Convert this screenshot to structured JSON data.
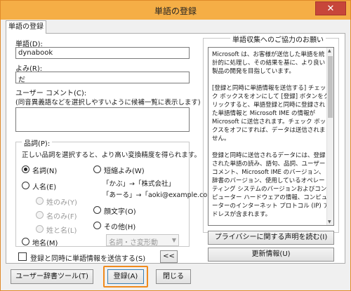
{
  "window": {
    "title": "単語の登録",
    "close_glyph": "✕"
  },
  "tab": {
    "label": "単語の登録"
  },
  "word": {
    "label": "単語(D):",
    "value": "dynabook"
  },
  "reading": {
    "label": "よみ(R):",
    "value": "だ"
  },
  "comment": {
    "label": "ユーザー コメント(C):",
    "hint": "(同音異義語などを選択しやすいように候補一覧に表示します)",
    "value": ""
  },
  "pos_group": {
    "title": "品詞(P):",
    "description": "正しい品詞を選択すると、より高い変換精度を得られます。",
    "options": {
      "noun": "名詞(N)",
      "abbrev": "短縮よみ(W)",
      "abbrev_example1": "「かぶ」→「株式会社」",
      "abbrev_example2": "「あーる」→「aoki@example.com」",
      "person": "人名(E)",
      "surname": "姓のみ(Y)",
      "given": "名のみ(F)",
      "fullname": "姓と名(L)",
      "emoticon": "顔文字(O)",
      "other": "その他(H)",
      "place": "地名(M)",
      "other_select": "名詞・さ変形動"
    }
  },
  "send_checkbox": {
    "label": "登録と同時に単語情報を送信する(S)",
    "checked": false
  },
  "collapse_button": "<<",
  "info_panel": {
    "title": "単語収集へのご協力のお願い",
    "text": "Microsoft は、お客様が送信した単語を統計的に処理し、その結果を基に、より良い製品の開発を目指しています。\n\n[登録と同時に単語情報を送信する] チェック ボックスをオンにして [登録] ボタンをクリックすると、単語登録と同時に登録された単語情報と Microsoft IME の情報が Microsoft に送信されます。チェック ボックスをオフにすれば、データは送信されません。\n\n登録と同時に送信されるデータには、登録された単語の読み、語句、品詞、ユーザー コメント、Microsoft IME のバージョン、辞書のバージョン、使用しているオペレーティング システムのバージョンおよびコンピューター ハードウェアの情報、コンピューターのインターネット プロトコル (IP) アドレスが含まれます。\n\nお客様特有の情報が収集されたデータに含まれることがあります。このような情報が存在する場合でも、Microsoft では、お客様を特定す",
    "privacy_button": "プライバシーに関する声明を読む(I)",
    "update_button": "更新情報(U)"
  },
  "footer": {
    "user_dict_button": "ユーザー辞書ツール(T)",
    "register_button": "登録(A)",
    "close_button": "閉じる"
  },
  "colors": {
    "titlebar": "#f5ae46",
    "close": "#c7463a",
    "highlight": "#f08a1c"
  }
}
